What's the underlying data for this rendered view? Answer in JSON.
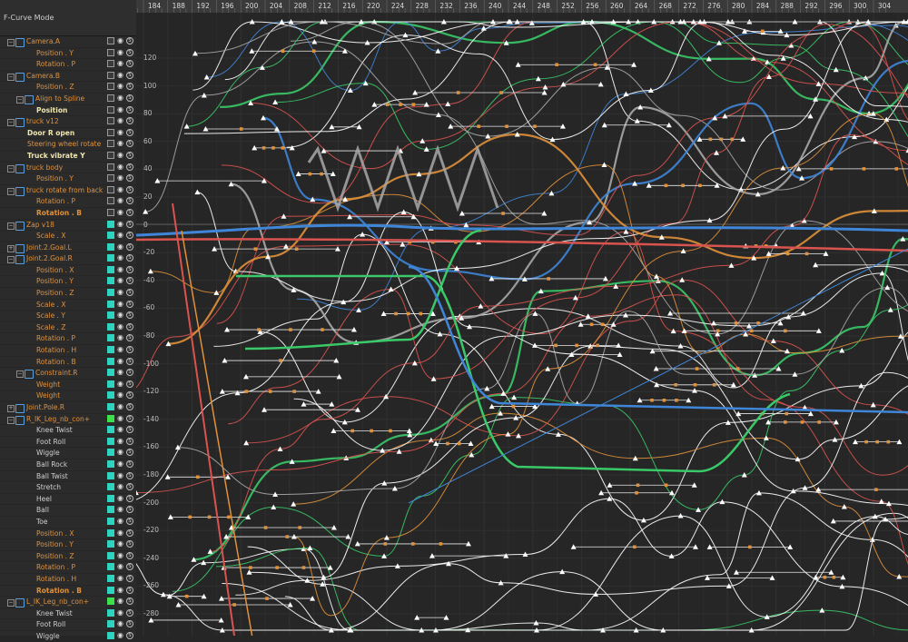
{
  "mode_label": "F-Curve Mode",
  "ruler_ticks": [
    "184",
    "188",
    "192",
    "196",
    "200",
    "204",
    "208",
    "212",
    "216",
    "220",
    "224",
    "228",
    "232",
    "236",
    "240",
    "244",
    "248",
    "252",
    "256",
    "260",
    "264",
    "268",
    "272",
    "276",
    "280",
    "284",
    "288",
    "292",
    "296",
    "300",
    "304"
  ],
  "y_axis_labels": [
    "120",
    "100",
    "80",
    "60",
    "40",
    "20",
    "0",
    "-20",
    "-40",
    "-60",
    "-80",
    "-100",
    "-120",
    "-140",
    "-160",
    "-180",
    "-200",
    "-220",
    "-240",
    "-260",
    "-280"
  ],
  "tracks": [
    {
      "label": "Camera.A",
      "kind": "obj",
      "indent": 0,
      "exp": "−",
      "icon": "camera-icon",
      "box": "plain"
    },
    {
      "label": "Position . Y",
      "kind": "track",
      "indent": 2,
      "box": "plain"
    },
    {
      "label": "Rotation . P",
      "kind": "track",
      "indent": 2,
      "box": "plain"
    },
    {
      "label": "Camera.B",
      "kind": "obj",
      "indent": 0,
      "exp": "−",
      "icon": "camera-icon",
      "box": "plain"
    },
    {
      "label": "Position . Z",
      "kind": "track",
      "indent": 2,
      "box": "plain"
    },
    {
      "label": "Align to Spline",
      "kind": "obj",
      "indent": 1,
      "exp": "−",
      "icon": "tag-icon",
      "box": "plain"
    },
    {
      "label": "Position",
      "kind": "boldw",
      "indent": 2,
      "box": "plain"
    },
    {
      "label": "truck v12",
      "kind": "obj",
      "indent": 0,
      "exp": "−",
      "icon": "null-icon",
      "box": "plain"
    },
    {
      "label": "Door R open",
      "kind": "boldw",
      "indent": 1,
      "box": "plain"
    },
    {
      "label": "Steering wheel rotate",
      "kind": "track",
      "indent": 1,
      "box": "plain"
    },
    {
      "label": "Truck vibrate Y",
      "kind": "boldw",
      "indent": 1,
      "box": "plain"
    },
    {
      "label": "truck body",
      "kind": "obj",
      "indent": 0,
      "exp": "−",
      "icon": "null-icon",
      "box": "plain"
    },
    {
      "label": "Position . Y",
      "kind": "track",
      "indent": 2,
      "box": "plain"
    },
    {
      "label": "truck rotate from back",
      "kind": "obj",
      "indent": 0,
      "exp": "−",
      "icon": "null-icon",
      "box": "plain"
    },
    {
      "label": "Rotation . P",
      "kind": "track",
      "indent": 2,
      "box": "plain"
    },
    {
      "label": "Rotation . B",
      "kind": "track bold",
      "indent": 2,
      "box": "plain"
    },
    {
      "label": "Zap v18",
      "kind": "obj",
      "indent": 0,
      "exp": "−",
      "icon": "null-icon",
      "box": "teal"
    },
    {
      "label": "Scale . X",
      "kind": "track",
      "indent": 2,
      "box": "teal"
    },
    {
      "label": "Joint.2.Goal.L",
      "kind": "obj",
      "indent": 0,
      "exp": "+",
      "icon": "null-icon",
      "box": "teal"
    },
    {
      "label": "Joint.2.Goal.R",
      "kind": "obj",
      "indent": 0,
      "exp": "−",
      "icon": "null-icon",
      "box": "teal"
    },
    {
      "label": "Position . X",
      "kind": "track",
      "indent": 2,
      "box": "teal"
    },
    {
      "label": "Position . Y",
      "kind": "track",
      "indent": 2,
      "box": "teal"
    },
    {
      "label": "Position . Z",
      "kind": "track",
      "indent": 2,
      "box": "teal"
    },
    {
      "label": "Scale . X",
      "kind": "track",
      "indent": 2,
      "box": "teal"
    },
    {
      "label": "Scale . Y",
      "kind": "track",
      "indent": 2,
      "box": "teal"
    },
    {
      "label": "Scale . Z",
      "kind": "track",
      "indent": 2,
      "box": "teal"
    },
    {
      "label": "Rotation . P",
      "kind": "track",
      "indent": 2,
      "box": "teal"
    },
    {
      "label": "Rotation . H",
      "kind": "track",
      "indent": 2,
      "box": "teal"
    },
    {
      "label": "Rotation . B",
      "kind": "track",
      "indent": 2,
      "box": "teal"
    },
    {
      "label": "Constraint.R",
      "kind": "obj",
      "indent": 1,
      "exp": "−",
      "icon": "constraint-icon",
      "box": "teal"
    },
    {
      "label": "Weight",
      "kind": "track",
      "indent": 2,
      "box": "teal"
    },
    {
      "label": "Weight",
      "kind": "track",
      "indent": 2,
      "box": "teal"
    },
    {
      "label": "Joint.Pole.R",
      "kind": "obj",
      "indent": 0,
      "exp": "+",
      "icon": "null-icon",
      "box": "teal"
    },
    {
      "label": "R_IK_Leg_nb_con+",
      "kind": "obj",
      "indent": 0,
      "exp": "−",
      "icon": "ik-icon",
      "box": "green"
    },
    {
      "label": "Knee Twist",
      "kind": "plain",
      "indent": 2,
      "box": "teal"
    },
    {
      "label": "Foot Roll",
      "kind": "plain",
      "indent": 2,
      "box": "teal"
    },
    {
      "label": "Wiggle",
      "kind": "plain",
      "indent": 2,
      "box": "teal"
    },
    {
      "label": "Ball Rock",
      "kind": "plain",
      "indent": 2,
      "box": "teal"
    },
    {
      "label": "Ball Twist",
      "kind": "plain",
      "indent": 2,
      "box": "teal"
    },
    {
      "label": "Stretch",
      "kind": "plain",
      "indent": 2,
      "box": "teal"
    },
    {
      "label": "Heel",
      "kind": "plain",
      "indent": 2,
      "box": "teal"
    },
    {
      "label": "Ball",
      "kind": "plain",
      "indent": 2,
      "box": "teal"
    },
    {
      "label": "Toe",
      "kind": "plain",
      "indent": 2,
      "box": "teal"
    },
    {
      "label": "Position . X",
      "kind": "track",
      "indent": 2,
      "box": "teal"
    },
    {
      "label": "Position . Y",
      "kind": "track",
      "indent": 2,
      "box": "teal"
    },
    {
      "label": "Position . Z",
      "kind": "track",
      "indent": 2,
      "box": "teal"
    },
    {
      "label": "Rotation . P",
      "kind": "track",
      "indent": 2,
      "box": "teal"
    },
    {
      "label": "Rotation . H",
      "kind": "track",
      "indent": 2,
      "box": "teal"
    },
    {
      "label": "Rotation . B",
      "kind": "track bold",
      "indent": 2,
      "box": "teal"
    },
    {
      "label": "L_IK_Leg_nb_con+",
      "kind": "obj",
      "indent": 0,
      "exp": "−",
      "icon": "ik-icon",
      "box": "green"
    },
    {
      "label": "Knee Twist",
      "kind": "plain",
      "indent": 2,
      "box": "teal"
    },
    {
      "label": "Foot Roll",
      "kind": "plain",
      "indent": 2,
      "box": "teal"
    },
    {
      "label": "Wiggle",
      "kind": "plain",
      "indent": 2,
      "box": "teal"
    }
  ],
  "colors": {
    "orange": "#e0913b",
    "blue": "#3f86d8",
    "green": "#3ac968",
    "red": "#d9534f",
    "gray": "#a8a8a8",
    "white": "#ffffff",
    "teal": "#2fd4c0"
  }
}
